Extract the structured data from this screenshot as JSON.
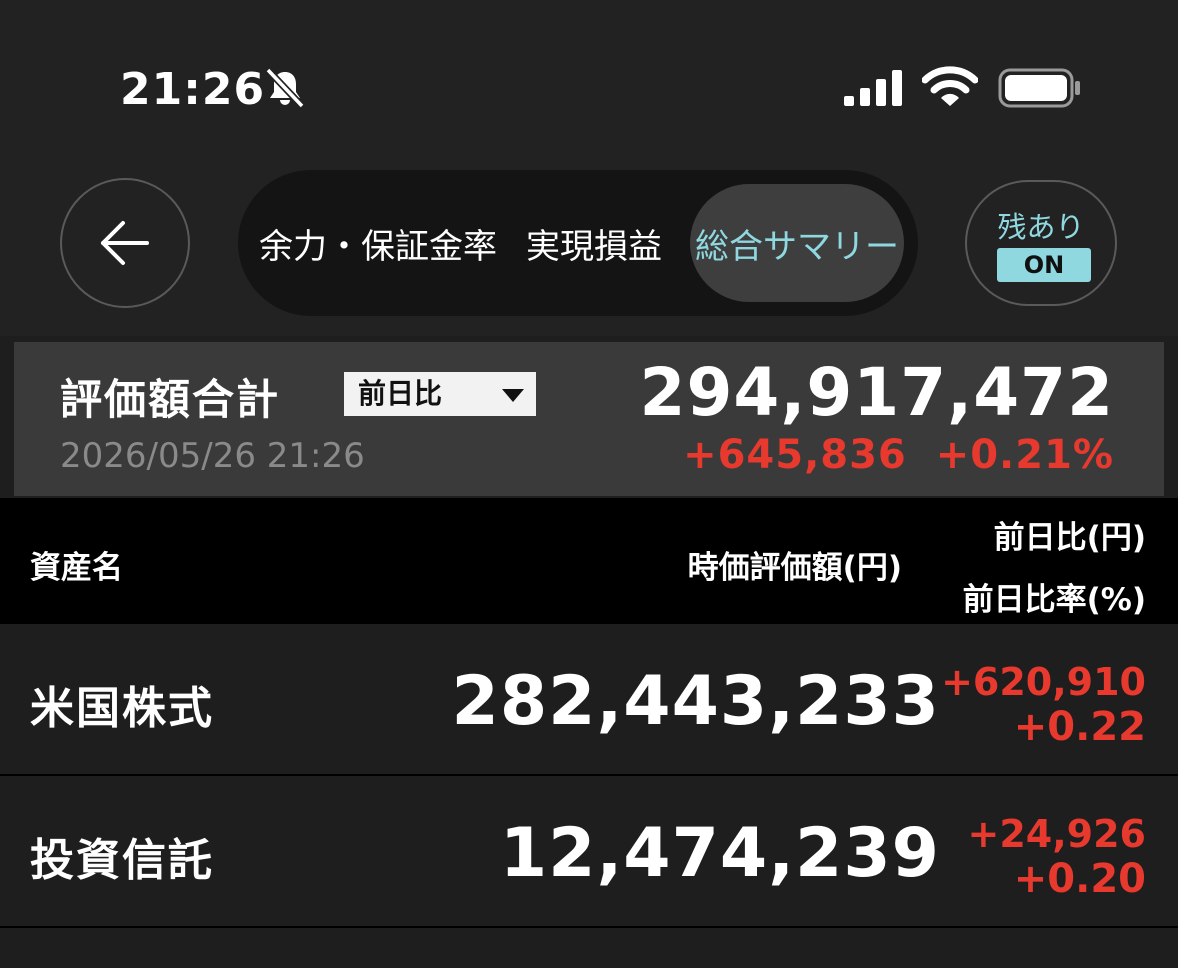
{
  "status_bar": {
    "time": "21:26",
    "icons": [
      "bell-slash-icon",
      "cellular-signal-icon",
      "wifi-icon",
      "battery-icon"
    ]
  },
  "nav": {
    "back_icon": "arrow-left-icon",
    "tabs": [
      {
        "label": "余力・保証金率",
        "selected": false
      },
      {
        "label": "実現損益",
        "selected": false
      },
      {
        "label": "総合サマリー",
        "selected": true
      }
    ],
    "residual_toggle": {
      "label": "残あり",
      "state": "ON"
    }
  },
  "summary": {
    "title": "評価額合計",
    "compare_option": "前日比",
    "timestamp": "2026/05/26 21:26",
    "total": "294,917,472",
    "change_amount": "+645,836",
    "change_percent": "+0.21%"
  },
  "table": {
    "headers": {
      "asset_name": "資産名",
      "market_value": "時価評価額(円)",
      "day_change": "前日比(円)",
      "day_change_rate": "前日比率(%)"
    },
    "rows": [
      {
        "name": "米国株式",
        "value": "282,443,233",
        "change": "+620,910",
        "change_rate": "+0.22"
      },
      {
        "name": "投資信託",
        "value": "12,474,239",
        "change": "+24,926",
        "change_rate": "+0.20"
      }
    ]
  },
  "colors": {
    "positive": "#e8392e",
    "accent": "#8fd8e0",
    "background": "#1e1e1e"
  }
}
